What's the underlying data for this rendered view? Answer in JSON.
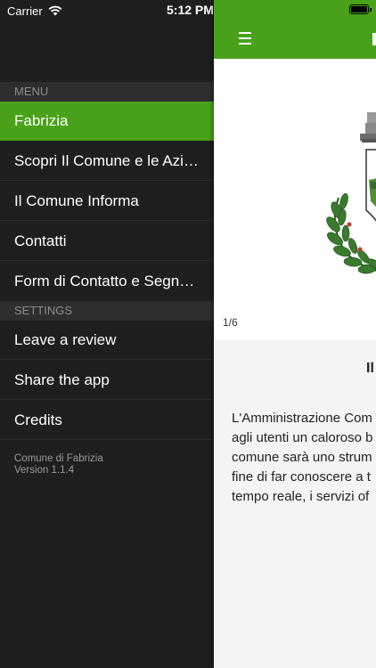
{
  "status_bar": {
    "carrier": "Carrier",
    "time": "5:12 PM"
  },
  "drawer": {
    "sections": {
      "menu": "MENU",
      "settings": "SETTINGS"
    },
    "menu_items": [
      {
        "label": "Fabrizia",
        "active": true
      },
      {
        "label": "Scopri Il Comune e le Aziende"
      },
      {
        "label": "Il Comune Informa"
      },
      {
        "label": "Contatti"
      },
      {
        "label": "Form di Contatto e Segnalazioni"
      }
    ],
    "settings_items": [
      {
        "label": "Leave a review"
      },
      {
        "label": "Share the app"
      },
      {
        "label": "Credits"
      }
    ],
    "footer": {
      "app_name": "Comune di Fabrizia",
      "version": "Version 1.1.4"
    }
  },
  "main": {
    "slider_counter": "1/6",
    "title_fragment": "Il",
    "body_lines": [
      "L'Amministrazione Com",
      "agli utenti un caloroso b",
      "comune  sarà uno strum",
      "fine di far conoscere a t",
      "tempo reale, i servizi of"
    ]
  },
  "colors": {
    "accent_green": "#49a21a",
    "drawer_bg": "#1f1f1f",
    "section_header_bg": "#2e2e2e"
  }
}
